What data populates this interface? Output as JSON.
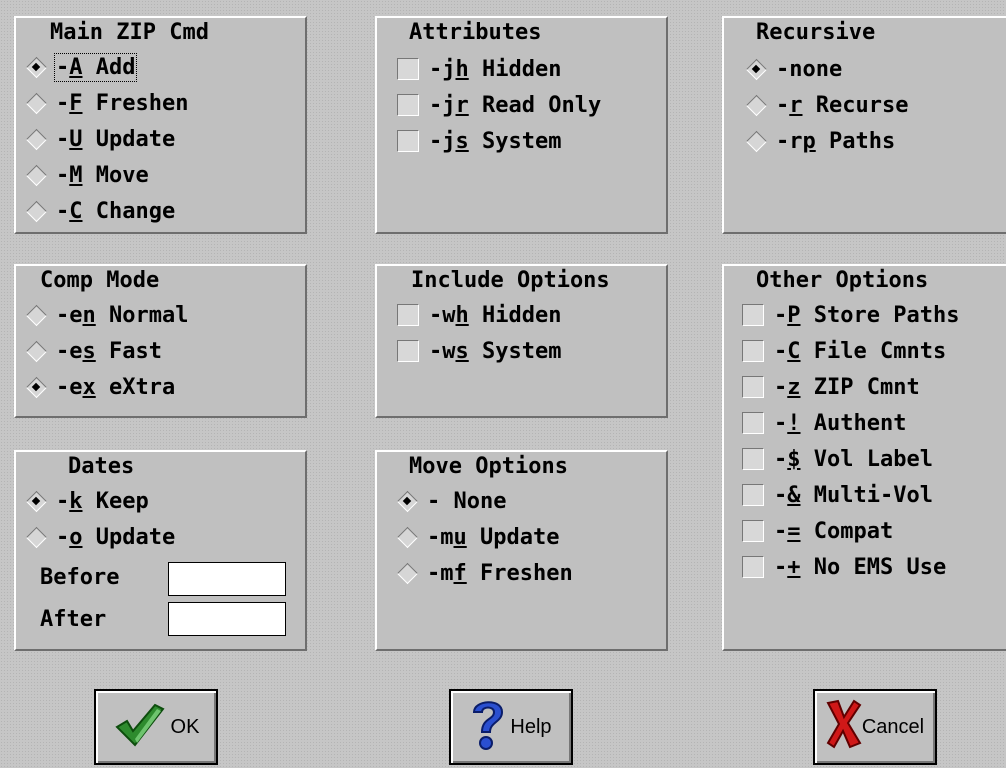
{
  "main_cmd": {
    "title": "Main ZIP Cmd",
    "options": [
      {
        "pre": "-",
        "u": "A",
        "post": " Add",
        "selected": true
      },
      {
        "pre": "-",
        "u": "F",
        "post": " Freshen",
        "selected": false
      },
      {
        "pre": "-",
        "u": "U",
        "post": " Update",
        "selected": false
      },
      {
        "pre": "-",
        "u": "M",
        "post": " Move",
        "selected": false
      },
      {
        "pre": "-",
        "u": "C",
        "post": " Change",
        "selected": false
      }
    ]
  },
  "attributes": {
    "title": "Attributes",
    "options": [
      {
        "pre": "-j",
        "u": "h",
        "post": " Hidden",
        "checked": false
      },
      {
        "pre": "-j",
        "u": "r",
        "post": " Read Only",
        "checked": false
      },
      {
        "pre": "-j",
        "u": "s",
        "post": " System",
        "checked": false
      }
    ]
  },
  "recursive": {
    "title": "Recursive",
    "options": [
      {
        "pre": "-none",
        "u": "",
        "post": "",
        "selected": true
      },
      {
        "pre": "-",
        "u": "r",
        "post": " Recurse",
        "selected": false
      },
      {
        "pre": "-r",
        "u": "p",
        "post": " Paths",
        "selected": false
      }
    ]
  },
  "comp_mode": {
    "title": "Comp Mode",
    "options": [
      {
        "pre": "-e",
        "u": "n",
        "post": " Normal",
        "selected": false
      },
      {
        "pre": "-e",
        "u": "s",
        "post": " Fast",
        "selected": false
      },
      {
        "pre": "-e",
        "u": "x",
        "post": " eXtra",
        "selected": true
      }
    ]
  },
  "include_options": {
    "title": "Include Options",
    "options": [
      {
        "pre": "-w",
        "u": "h",
        "post": " Hidden",
        "checked": false
      },
      {
        "pre": "-w",
        "u": "s",
        "post": " System",
        "checked": false
      }
    ]
  },
  "other_options": {
    "title": "Other Options",
    "options": [
      {
        "pre": "-",
        "u": "P",
        "post": " Store Paths",
        "checked": false
      },
      {
        "pre": "-",
        "u": "C",
        "post": " File Cmnts",
        "checked": false
      },
      {
        "pre": "-",
        "u": "z",
        "post": " ZIP Cmnt",
        "checked": false
      },
      {
        "pre": "-",
        "u": "!",
        "post": " Authent",
        "checked": false
      },
      {
        "pre": "-",
        "u": "$",
        "post": " Vol Label",
        "checked": false
      },
      {
        "pre": "-",
        "u": "&",
        "post": " Multi-Vol",
        "checked": false
      },
      {
        "pre": "-",
        "u": "=",
        "post": " Compat",
        "checked": false
      },
      {
        "pre": "-",
        "u": "+",
        "post": " No EMS Use",
        "checked": false
      }
    ]
  },
  "dates": {
    "title": "Dates",
    "options": [
      {
        "pre": "-",
        "u": "k",
        "post": " Keep",
        "selected": true
      },
      {
        "pre": "-",
        "u": "o",
        "post": " Update",
        "selected": false
      }
    ],
    "before_label": "Before",
    "before_value": "",
    "after_label": "After",
    "after_value": ""
  },
  "move_options": {
    "title": "Move Options",
    "options": [
      {
        "pre": "- None",
        "u": "",
        "post": "",
        "selected": true
      },
      {
        "pre": "-m",
        "u": "u",
        "post": " Update",
        "selected": false
      },
      {
        "pre": "-m",
        "u": "f",
        "post": " Freshen",
        "selected": false
      }
    ]
  },
  "buttons": {
    "ok": "OK",
    "help": "Help",
    "cancel": "Cancel"
  }
}
